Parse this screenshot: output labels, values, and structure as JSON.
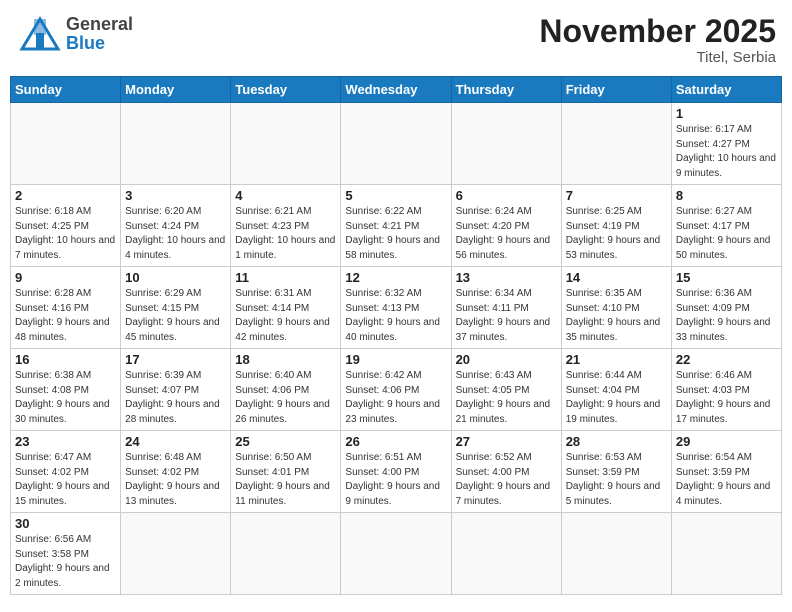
{
  "header": {
    "logo_general": "General",
    "logo_blue": "Blue",
    "month_year": "November 2025",
    "location": "Titel, Serbia"
  },
  "days_of_week": [
    "Sunday",
    "Monday",
    "Tuesday",
    "Wednesday",
    "Thursday",
    "Friday",
    "Saturday"
  ],
  "weeks": [
    [
      {
        "day": "",
        "info": ""
      },
      {
        "day": "",
        "info": ""
      },
      {
        "day": "",
        "info": ""
      },
      {
        "day": "",
        "info": ""
      },
      {
        "day": "",
        "info": ""
      },
      {
        "day": "",
        "info": ""
      },
      {
        "day": "1",
        "info": "Sunrise: 6:17 AM\nSunset: 4:27 PM\nDaylight: 10 hours\nand 9 minutes."
      }
    ],
    [
      {
        "day": "2",
        "info": "Sunrise: 6:18 AM\nSunset: 4:25 PM\nDaylight: 10 hours\nand 7 minutes."
      },
      {
        "day": "3",
        "info": "Sunrise: 6:20 AM\nSunset: 4:24 PM\nDaylight: 10 hours\nand 4 minutes."
      },
      {
        "day": "4",
        "info": "Sunrise: 6:21 AM\nSunset: 4:23 PM\nDaylight: 10 hours\nand 1 minute."
      },
      {
        "day": "5",
        "info": "Sunrise: 6:22 AM\nSunset: 4:21 PM\nDaylight: 9 hours\nand 58 minutes."
      },
      {
        "day": "6",
        "info": "Sunrise: 6:24 AM\nSunset: 4:20 PM\nDaylight: 9 hours\nand 56 minutes."
      },
      {
        "day": "7",
        "info": "Sunrise: 6:25 AM\nSunset: 4:19 PM\nDaylight: 9 hours\nand 53 minutes."
      },
      {
        "day": "8",
        "info": "Sunrise: 6:27 AM\nSunset: 4:17 PM\nDaylight: 9 hours\nand 50 minutes."
      }
    ],
    [
      {
        "day": "9",
        "info": "Sunrise: 6:28 AM\nSunset: 4:16 PM\nDaylight: 9 hours\nand 48 minutes."
      },
      {
        "day": "10",
        "info": "Sunrise: 6:29 AM\nSunset: 4:15 PM\nDaylight: 9 hours\nand 45 minutes."
      },
      {
        "day": "11",
        "info": "Sunrise: 6:31 AM\nSunset: 4:14 PM\nDaylight: 9 hours\nand 42 minutes."
      },
      {
        "day": "12",
        "info": "Sunrise: 6:32 AM\nSunset: 4:13 PM\nDaylight: 9 hours\nand 40 minutes."
      },
      {
        "day": "13",
        "info": "Sunrise: 6:34 AM\nSunset: 4:11 PM\nDaylight: 9 hours\nand 37 minutes."
      },
      {
        "day": "14",
        "info": "Sunrise: 6:35 AM\nSunset: 4:10 PM\nDaylight: 9 hours\nand 35 minutes."
      },
      {
        "day": "15",
        "info": "Sunrise: 6:36 AM\nSunset: 4:09 PM\nDaylight: 9 hours\nand 33 minutes."
      }
    ],
    [
      {
        "day": "16",
        "info": "Sunrise: 6:38 AM\nSunset: 4:08 PM\nDaylight: 9 hours\nand 30 minutes."
      },
      {
        "day": "17",
        "info": "Sunrise: 6:39 AM\nSunset: 4:07 PM\nDaylight: 9 hours\nand 28 minutes."
      },
      {
        "day": "18",
        "info": "Sunrise: 6:40 AM\nSunset: 4:06 PM\nDaylight: 9 hours\nand 26 minutes."
      },
      {
        "day": "19",
        "info": "Sunrise: 6:42 AM\nSunset: 4:06 PM\nDaylight: 9 hours\nand 23 minutes."
      },
      {
        "day": "20",
        "info": "Sunrise: 6:43 AM\nSunset: 4:05 PM\nDaylight: 9 hours\nand 21 minutes."
      },
      {
        "day": "21",
        "info": "Sunrise: 6:44 AM\nSunset: 4:04 PM\nDaylight: 9 hours\nand 19 minutes."
      },
      {
        "day": "22",
        "info": "Sunrise: 6:46 AM\nSunset: 4:03 PM\nDaylight: 9 hours\nand 17 minutes."
      }
    ],
    [
      {
        "day": "23",
        "info": "Sunrise: 6:47 AM\nSunset: 4:02 PM\nDaylight: 9 hours\nand 15 minutes."
      },
      {
        "day": "24",
        "info": "Sunrise: 6:48 AM\nSunset: 4:02 PM\nDaylight: 9 hours\nand 13 minutes."
      },
      {
        "day": "25",
        "info": "Sunrise: 6:50 AM\nSunset: 4:01 PM\nDaylight: 9 hours\nand 11 minutes."
      },
      {
        "day": "26",
        "info": "Sunrise: 6:51 AM\nSunset: 4:00 PM\nDaylight: 9 hours\nand 9 minutes."
      },
      {
        "day": "27",
        "info": "Sunrise: 6:52 AM\nSunset: 4:00 PM\nDaylight: 9 hours\nand 7 minutes."
      },
      {
        "day": "28",
        "info": "Sunrise: 6:53 AM\nSunset: 3:59 PM\nDaylight: 9 hours\nand 5 minutes."
      },
      {
        "day": "29",
        "info": "Sunrise: 6:54 AM\nSunset: 3:59 PM\nDaylight: 9 hours\nand 4 minutes."
      }
    ],
    [
      {
        "day": "30",
        "info": "Sunrise: 6:56 AM\nSunset: 3:58 PM\nDaylight: 9 hours\nand 2 minutes."
      },
      {
        "day": "",
        "info": ""
      },
      {
        "day": "",
        "info": ""
      },
      {
        "day": "",
        "info": ""
      },
      {
        "day": "",
        "info": ""
      },
      {
        "day": "",
        "info": ""
      },
      {
        "day": "",
        "info": ""
      }
    ]
  ]
}
